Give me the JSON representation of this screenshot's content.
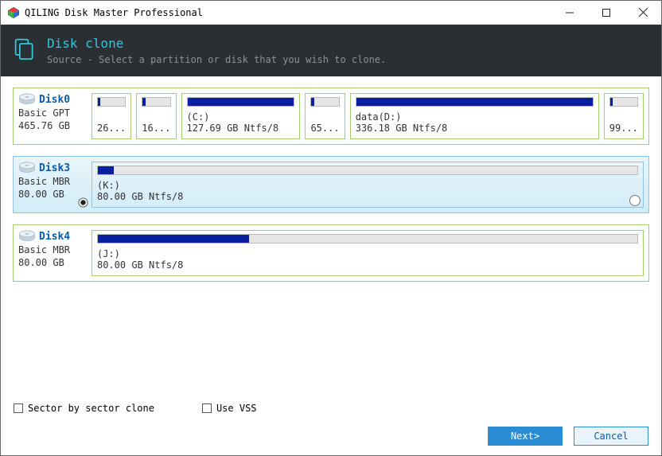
{
  "window": {
    "title": "QILING Disk Master Professional"
  },
  "banner": {
    "title": "Disk clone",
    "subtitle": "Source - Select a partition or disk that you wish to clone."
  },
  "disks": [
    {
      "name": "Disk0",
      "type": "Basic GPT",
      "size": "465.76 GB",
      "selected": false,
      "partitions": [
        {
          "label": "",
          "info": "26...",
          "fill": 10,
          "flex": 40
        },
        {
          "label": "",
          "info": "16...",
          "fill": 10,
          "flex": 40
        },
        {
          "label": "(C:)",
          "info": "127.69 GB Ntfs/8",
          "fill": 100,
          "flex": 150
        },
        {
          "label": "",
          "info": "65...",
          "fill": 10,
          "flex": 40
        },
        {
          "label": "data(D:)",
          "info": "336.18 GB Ntfs/8",
          "fill": 100,
          "flex": 330
        },
        {
          "label": "",
          "info": "99...",
          "fill": 10,
          "flex": 40
        }
      ]
    },
    {
      "name": "Disk3",
      "type": "Basic MBR",
      "size": "80.00 GB",
      "selected": true,
      "partitions": [
        {
          "label": "(K:)",
          "info": "80.00 GB Ntfs/8",
          "fill": 3,
          "flex": 1
        }
      ]
    },
    {
      "name": "Disk4",
      "type": "Basic MBR",
      "size": "80.00 GB",
      "selected": false,
      "partitions": [
        {
          "label": "(J:)",
          "info": "80.00 GB Ntfs/8",
          "fill": 28,
          "flex": 1
        }
      ]
    }
  ],
  "options": {
    "sector": "Sector by sector clone",
    "vss": "Use VSS"
  },
  "buttons": {
    "next": "Next>",
    "cancel": "Cancel"
  }
}
